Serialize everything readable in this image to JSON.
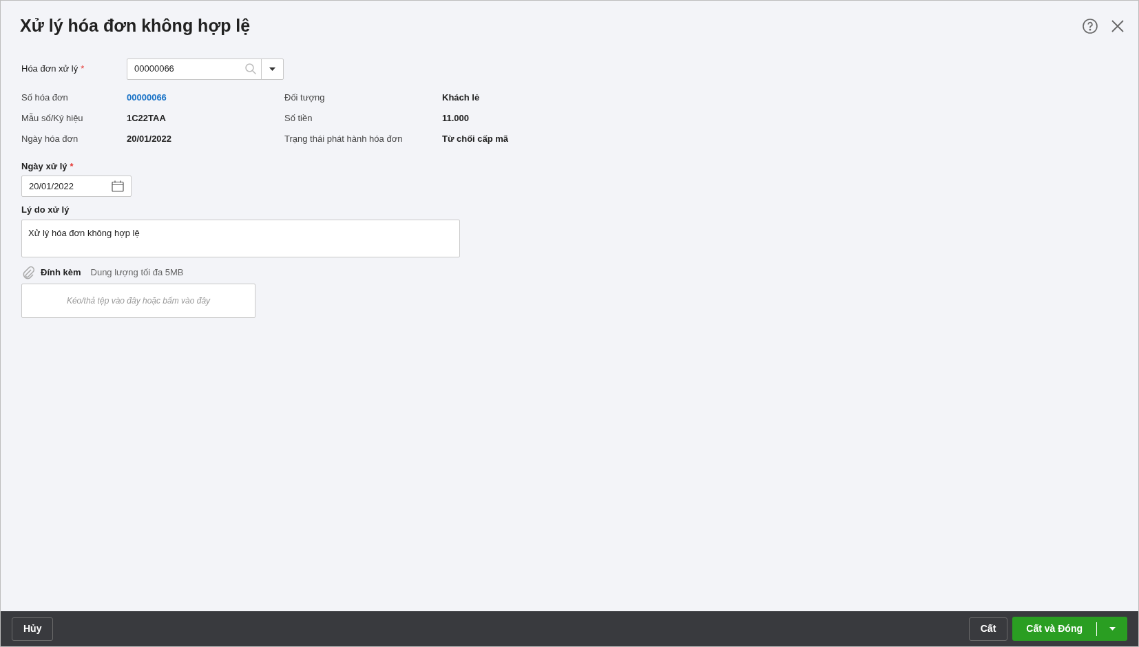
{
  "dialog": {
    "title": "Xử lý hóa đơn không hợp lệ"
  },
  "invoice_field": {
    "label": "Hóa đơn xử lý",
    "required_mark": "*",
    "value": "00000066"
  },
  "info": [
    {
      "label": "Số hóa đơn",
      "value": "00000066",
      "kind": "link"
    },
    {
      "label": "Đối tượng",
      "value": "Khách lẻ",
      "kind": "text"
    },
    {
      "label": "Mẫu số/Ký hiệu",
      "value": "1C22TAA",
      "kind": "text"
    },
    {
      "label": "Số tiền",
      "value": "11.000",
      "kind": "text"
    },
    {
      "label": "Ngày hóa đơn",
      "value": "20/01/2022",
      "kind": "text"
    },
    {
      "label": "Trạng thái phát hành hóa đơn",
      "value": "Từ chối cấp mã",
      "kind": "text"
    }
  ],
  "date_field": {
    "label": "Ngày xử lý",
    "required_mark": "*",
    "value": "20/01/2022"
  },
  "reason_field": {
    "label": "Lý do xử lý",
    "value": "Xử lý hóa đơn không hợp lệ"
  },
  "attachment": {
    "label": "Đính kèm",
    "hint": "Dung lượng tối đa 5MB",
    "drop_text": "Kéo/thả tệp vào đây hoặc bấm vào đây"
  },
  "footer": {
    "cancel": "Hủy",
    "save": "Cất",
    "save_close": "Cất và Đóng"
  }
}
